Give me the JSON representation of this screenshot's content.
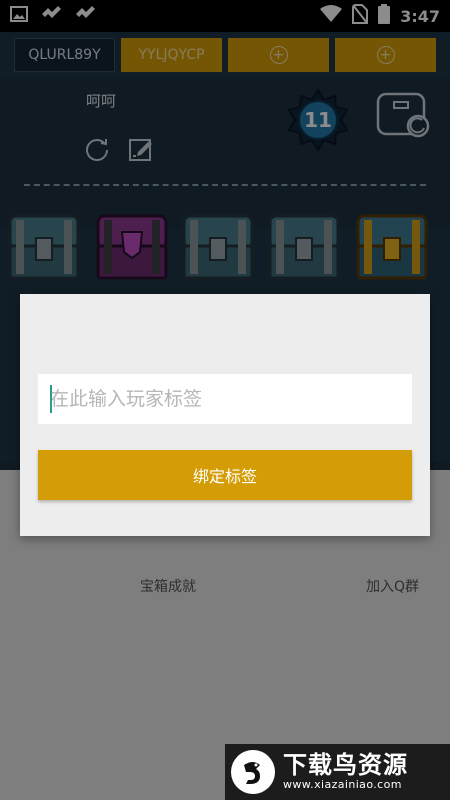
{
  "status_bar": {
    "time": "3:47",
    "left_icons": [
      "image-icon",
      "app-icon",
      "app-icon"
    ],
    "right_icons": [
      "wifi-icon",
      "no-sim-icon",
      "battery-icon"
    ]
  },
  "tag_tabs": [
    {
      "label": "QLURL89Y",
      "state": "active"
    },
    {
      "label": "YYLJQYCP",
      "state": "inactive"
    },
    {
      "label": "",
      "state": "add",
      "icon": "plus-circle-icon"
    },
    {
      "label": "",
      "state": "add",
      "icon": "plus-circle-icon"
    }
  ],
  "profile": {
    "player_name": "呵呵",
    "level": "11",
    "icons": [
      "refresh-icon",
      "edit-icon",
      "deck-icon"
    ]
  },
  "chests": [
    "silver-chest",
    "magical-chest",
    "silver-chest",
    "silver-chest",
    "golden-chest"
  ],
  "bottom_links": {
    "achievements": "宝箱成就",
    "join_group": "加入Q群"
  },
  "dialog": {
    "input_placeholder": "在此输入玩家标签",
    "input_value": "",
    "bind_button": "绑定标签"
  },
  "watermark": {
    "title": "下载鸟资源",
    "url": "www.xiazainiao.com"
  },
  "colors": {
    "accent_gold": "#d49d08",
    "app_background": "#1f3545",
    "dialog_background": "#ededed"
  }
}
